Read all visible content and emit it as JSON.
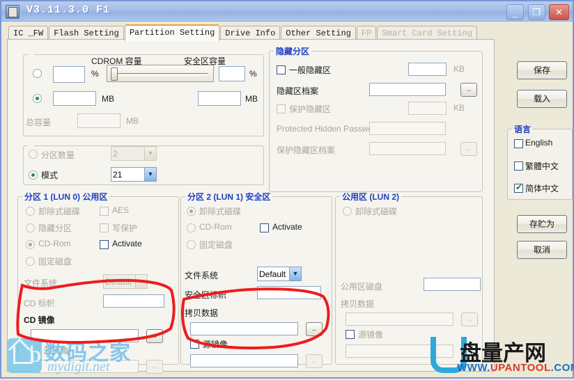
{
  "window": {
    "title": "V3.11.3.0 F1",
    "minimize": "_",
    "maximize": "❐",
    "close": "✕"
  },
  "tabs": [
    {
      "label": "IC _FW",
      "state": "normal"
    },
    {
      "label": "Flash Setting",
      "state": "normal"
    },
    {
      "label": "Partition Setting",
      "state": "active"
    },
    {
      "label": "Drive Info",
      "state": "normal"
    },
    {
      "label": "Other Setting",
      "state": "normal"
    },
    {
      "label": "FP",
      "state": "disabled"
    },
    {
      "label": "Smart Card Setting",
      "state": "disabled"
    }
  ],
  "capacity": {
    "cdrom_title": "CDROM 容量",
    "secure_title": "安全区容量",
    "percent_unit_left": "%",
    "percent_unit_right": "%",
    "mb_unit_left": "MB",
    "mb_unit_right": "MB",
    "total_label": "总容量",
    "total_unit": "MB",
    "cdrom_percent_value": "",
    "secure_percent_value": "",
    "cdrom_mb_value": "",
    "secure_mb_value": "",
    "total_value": "",
    "slider_value": 2,
    "radio_percent_selected": false,
    "radio_mb_selected": true
  },
  "partition_mode": {
    "count_label": "分区数量",
    "count_value": "2",
    "count_options": [
      "2"
    ],
    "mode_label": "模式",
    "mode_value": "21",
    "mode_options": [
      "21"
    ],
    "count_selected": false,
    "mode_selected": true
  },
  "hidden": {
    "legend": "隐藏分区",
    "normal_hidden_label": "一般隐藏区",
    "normal_hidden_checked": false,
    "normal_hidden_size": "",
    "normal_hidden_unit": "KB",
    "hidden_file_label": "隐藏区档案",
    "hidden_file_value": "",
    "browse": "..",
    "protected_hidden_label": "保护隐藏区",
    "protected_hidden_checked": false,
    "protected_hidden_size": "",
    "protected_hidden_unit": "KB",
    "password_label": "Protected Hidden Password",
    "password_value": "",
    "protected_file_label": "保护隐藏区档案",
    "protected_file_value": "",
    "browse2": ".."
  },
  "lun0": {
    "legend": "分区 1 (LUN 0) 公用区",
    "radios": [
      {
        "label": "卸除式磁碟",
        "selected": false
      },
      {
        "label": "隐藏分区",
        "selected": false
      },
      {
        "label": "CD-Rom",
        "selected": true
      },
      {
        "label": "固定磁盘",
        "selected": false
      }
    ],
    "checks": [
      {
        "label": "AES",
        "checked": false
      },
      {
        "label": "写保护",
        "checked": false
      },
      {
        "label": "Activate",
        "checked": false
      }
    ],
    "fs_label": "文件系统",
    "fs_value": "Default",
    "fs_options": [
      "Default"
    ],
    "cd_label_label": "CD 标帜",
    "cd_label_value": "",
    "cd_image_label": "CD 镜像",
    "cd_image_value": "",
    "browse": "..",
    "source_image_label": "源镜像",
    "source_image_checked": false,
    "source_image_value": "",
    "browse2": ".."
  },
  "lun1": {
    "legend": "分区 2 (LUN 1) 安全区",
    "radios": [
      {
        "label": "卸除式磁碟",
        "selected": true
      },
      {
        "label": "CD-Rom",
        "selected": false
      },
      {
        "label": "固定磁盘",
        "selected": false
      }
    ],
    "activate_label": "Activate",
    "activate_checked": false,
    "fs_label": "文件系统",
    "fs_value": "Default",
    "fs_options": [
      "Default"
    ],
    "sec_label_label": "安全区标帜",
    "sec_label_value": "",
    "copy_data_label": "拷贝数据",
    "copy_data_value": "",
    "browse": "..",
    "source_image_label": "源镜像",
    "source_image_checked": false,
    "source_image_value": "",
    "browse2": ".."
  },
  "lun2": {
    "legend": "公用区 (LUN 2)",
    "removable_label": "卸除式磁碟",
    "removable_selected": false,
    "disk_label": "公用区磁盘",
    "disk_value": "",
    "copy_data_label": "拷贝数据",
    "copy_data_value": "",
    "browse": "..",
    "source_image_label": "源镜像",
    "source_image_checked": false,
    "source_image_value": "",
    "browse2": ".."
  },
  "sidebar": {
    "save": "保存",
    "load": "载入",
    "lang_legend": "语言",
    "languages": [
      {
        "label": "English",
        "checked": false
      },
      {
        "label": "繁體中文",
        "checked": false
      },
      {
        "label": "简体中文",
        "checked": true
      }
    ],
    "save_as": "存贮为",
    "cancel": "取消"
  },
  "watermarks": {
    "left_cn": "数码之家",
    "left_en": "mydigit.net",
    "left_logo_letter": "D",
    "right_cn": "盘量产网",
    "right_en_prefix": "WWW.",
    "right_en_mid": "UPANTOOL",
    "right_en_suffix": ".COM"
  },
  "colors": {
    "accent_blue": "#26309b",
    "active_tab": "#f0a030",
    "annotation_red": "#ee1c1c",
    "title_bar": "#a3bde7"
  }
}
